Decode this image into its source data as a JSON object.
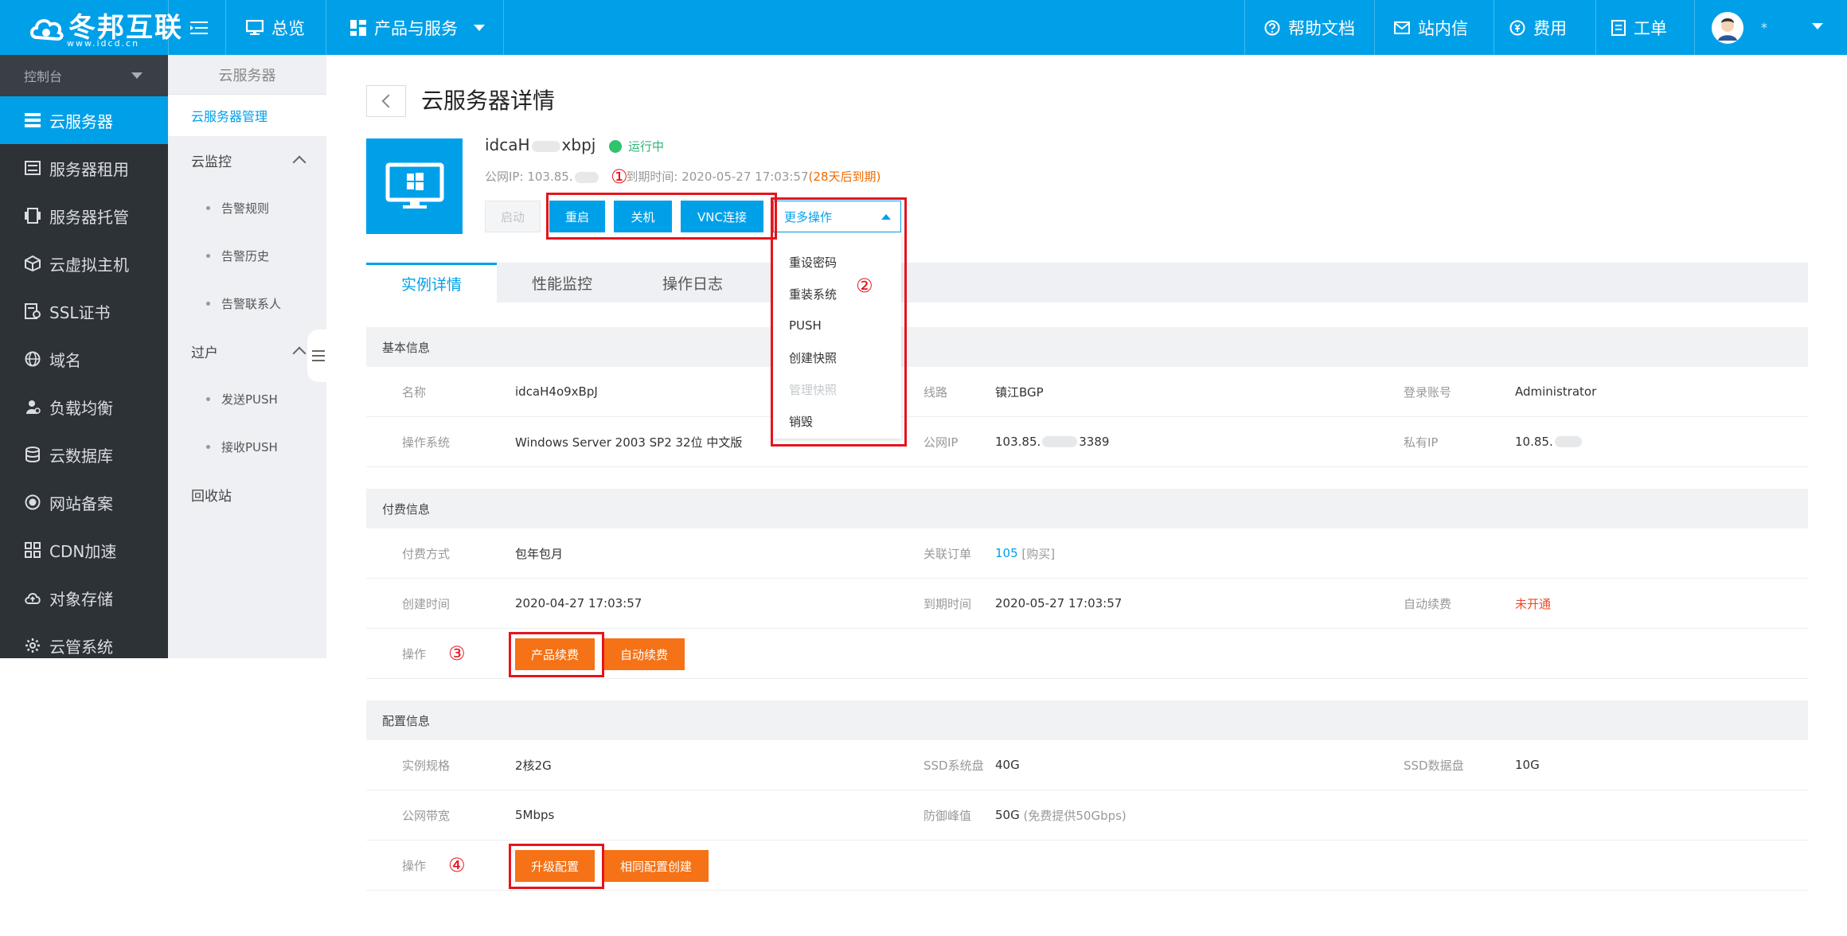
{
  "topbar": {
    "logo_text": "冬邦互联",
    "logo_url": "www.idcd.cn",
    "menu_icon": "menu-icon",
    "overview": "总览",
    "products": "产品与服务",
    "help": "帮助文档",
    "mail": "站内信",
    "fees": "费用",
    "ticket": "工单",
    "user_name": "*"
  },
  "leftnav": {
    "console": "控制台",
    "items": [
      {
        "label": "云服务器",
        "icon": "server-list-icon"
      },
      {
        "label": "服务器租用",
        "icon": "server-rack-icon"
      },
      {
        "label": "服务器托管",
        "icon": "hosting-icon"
      },
      {
        "label": "云虚拟主机",
        "icon": "cube-icon"
      },
      {
        "label": "SSL证书",
        "icon": "certificate-icon"
      },
      {
        "label": "域名",
        "icon": "globe-icon"
      },
      {
        "label": "负载均衡",
        "icon": "users-icon"
      },
      {
        "label": "云数据库",
        "icon": "database-icon"
      },
      {
        "label": "网站备案",
        "icon": "record-icon"
      },
      {
        "label": "CDN加速",
        "icon": "grid-icon"
      },
      {
        "label": "对象存储",
        "icon": "cloud-icon"
      },
      {
        "label": "云管系统",
        "icon": "gear-icon"
      }
    ]
  },
  "subnav": {
    "title": "云服务器",
    "selected": "云服务器管理",
    "monitor": "云监控",
    "monitor_children": [
      "告警规则",
      "告警历史",
      "告警联系人"
    ],
    "transfer": "过户",
    "transfer_children": [
      "发送PUSH",
      "接收PUSH"
    ],
    "recycle": "回收站"
  },
  "header": {
    "title": "云服务器详情",
    "instance_name_prefix": "idcaH",
    "instance_name_suffix": "xbpj",
    "status": "运行中",
    "ip_label": "公网IP:",
    "ip_value": "103.85.",
    "expire_label": "到期时间:",
    "expire_value": "2020-05-27 17:03:57",
    "expire_warn": "(28天后到期)"
  },
  "buttons": {
    "start": "启动",
    "restart": "重启",
    "shutdown": "关机",
    "vnc": "VNC连接",
    "more": "更多操作"
  },
  "dropdown": [
    "重设密码",
    "重装系统",
    "PUSH",
    "创建快照",
    "管理快照",
    "销毁"
  ],
  "annotations": [
    "①",
    "②",
    "③",
    "④"
  ],
  "tabs": [
    "实例详情",
    "性能监控",
    "操作日志"
  ],
  "basic": {
    "title": "基本信息",
    "name_label": "名称",
    "name_value": "idcaH4o9xBpJ",
    "line_label": "线路",
    "line_value": "镇江BGP",
    "login_label": "登录账号",
    "login_value": "Administrator",
    "os_label": "操作系统",
    "os_value": "Windows Server 2003 SP2 32位 中文版",
    "public_ip_label": "公网IP",
    "public_ip_prefix": "103.85.",
    "public_ip_suffix": "3389",
    "private_ip_label": "私有IP",
    "private_ip_value": "10.85."
  },
  "billing": {
    "title": "付费信息",
    "pay_label": "付费方式",
    "pay_value": "包年包月",
    "order_label": "关联订单",
    "order_value": "105",
    "order_link": "[购买]",
    "create_label": "创建时间",
    "create_value": "2020-04-27 17:03:57",
    "expire_label": "到期时间",
    "expire_value": "2020-05-27 17:03:57",
    "auto_label": "自动续费",
    "auto_value": "未开通",
    "ops_label": "操作",
    "renew_btn": "产品续费",
    "auto_btn": "自动续费"
  },
  "config": {
    "title": "配置信息",
    "spec_label": "实例规格",
    "spec_value": "2核2G",
    "sysdisk_label": "SSD系统盘",
    "sysdisk_value": "40G",
    "datadisk_label": "SSD数据盘",
    "datadisk_value": "10G",
    "bw_label": "公网带宽",
    "bw_value": "5Mbps",
    "ddos_label": "防御峰值",
    "ddos_value": "50G",
    "ddos_note": "(免费提供50Gbps)",
    "ops_label": "操作",
    "upgrade_btn": "升级配置",
    "clone_btn": "相同配置创建"
  },
  "colors": {
    "accent": "#00a0e9",
    "sidebar": "#2d3237",
    "orange": "#f57216",
    "annotation": "#e5141d",
    "running": "#2fc36c"
  }
}
